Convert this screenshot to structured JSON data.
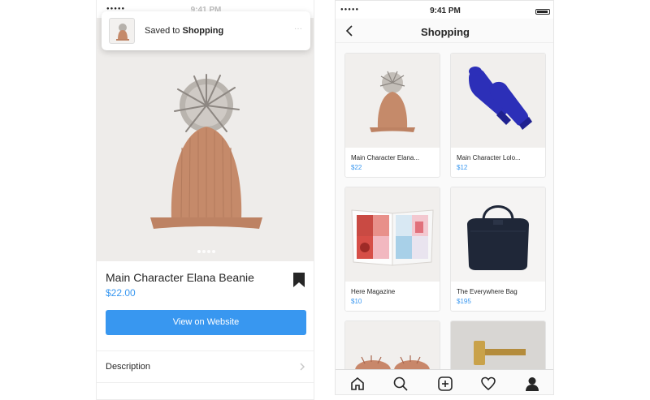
{
  "left_phone": {
    "status": {
      "time": "9:41 PM",
      "signal": "●●●●●"
    },
    "toast": {
      "prefix": "Saved to",
      "collection": "Shopping",
      "more": "···"
    },
    "product": {
      "name": "Main Character Elana Beanie",
      "price": "$22.00",
      "view_button": "View on Website",
      "description_label": "Description"
    },
    "carousel": {
      "count": 4,
      "active": 0
    }
  },
  "right_phone": {
    "status": {
      "time": "9:41 PM",
      "signal": "●●●●●"
    },
    "title": "Shopping",
    "items": [
      {
        "name": "Main Character Elana...",
        "price": "$22"
      },
      {
        "name": "Main Character Lolo...",
        "price": "$12"
      },
      {
        "name": "Here Magazine",
        "price": "$10"
      },
      {
        "name": "The Everywhere Bag",
        "price": "$195"
      },
      {
        "name": "",
        "price": ""
      },
      {
        "name": "",
        "price": ""
      }
    ],
    "tabs": [
      "home-icon",
      "search-icon",
      "add-post-icon",
      "heart-icon",
      "profile-icon"
    ]
  },
  "colors": {
    "accent": "#3897f0",
    "beanie": "#c58a6a",
    "mittens": "#2c2fb8",
    "bag": "#1f2738"
  }
}
